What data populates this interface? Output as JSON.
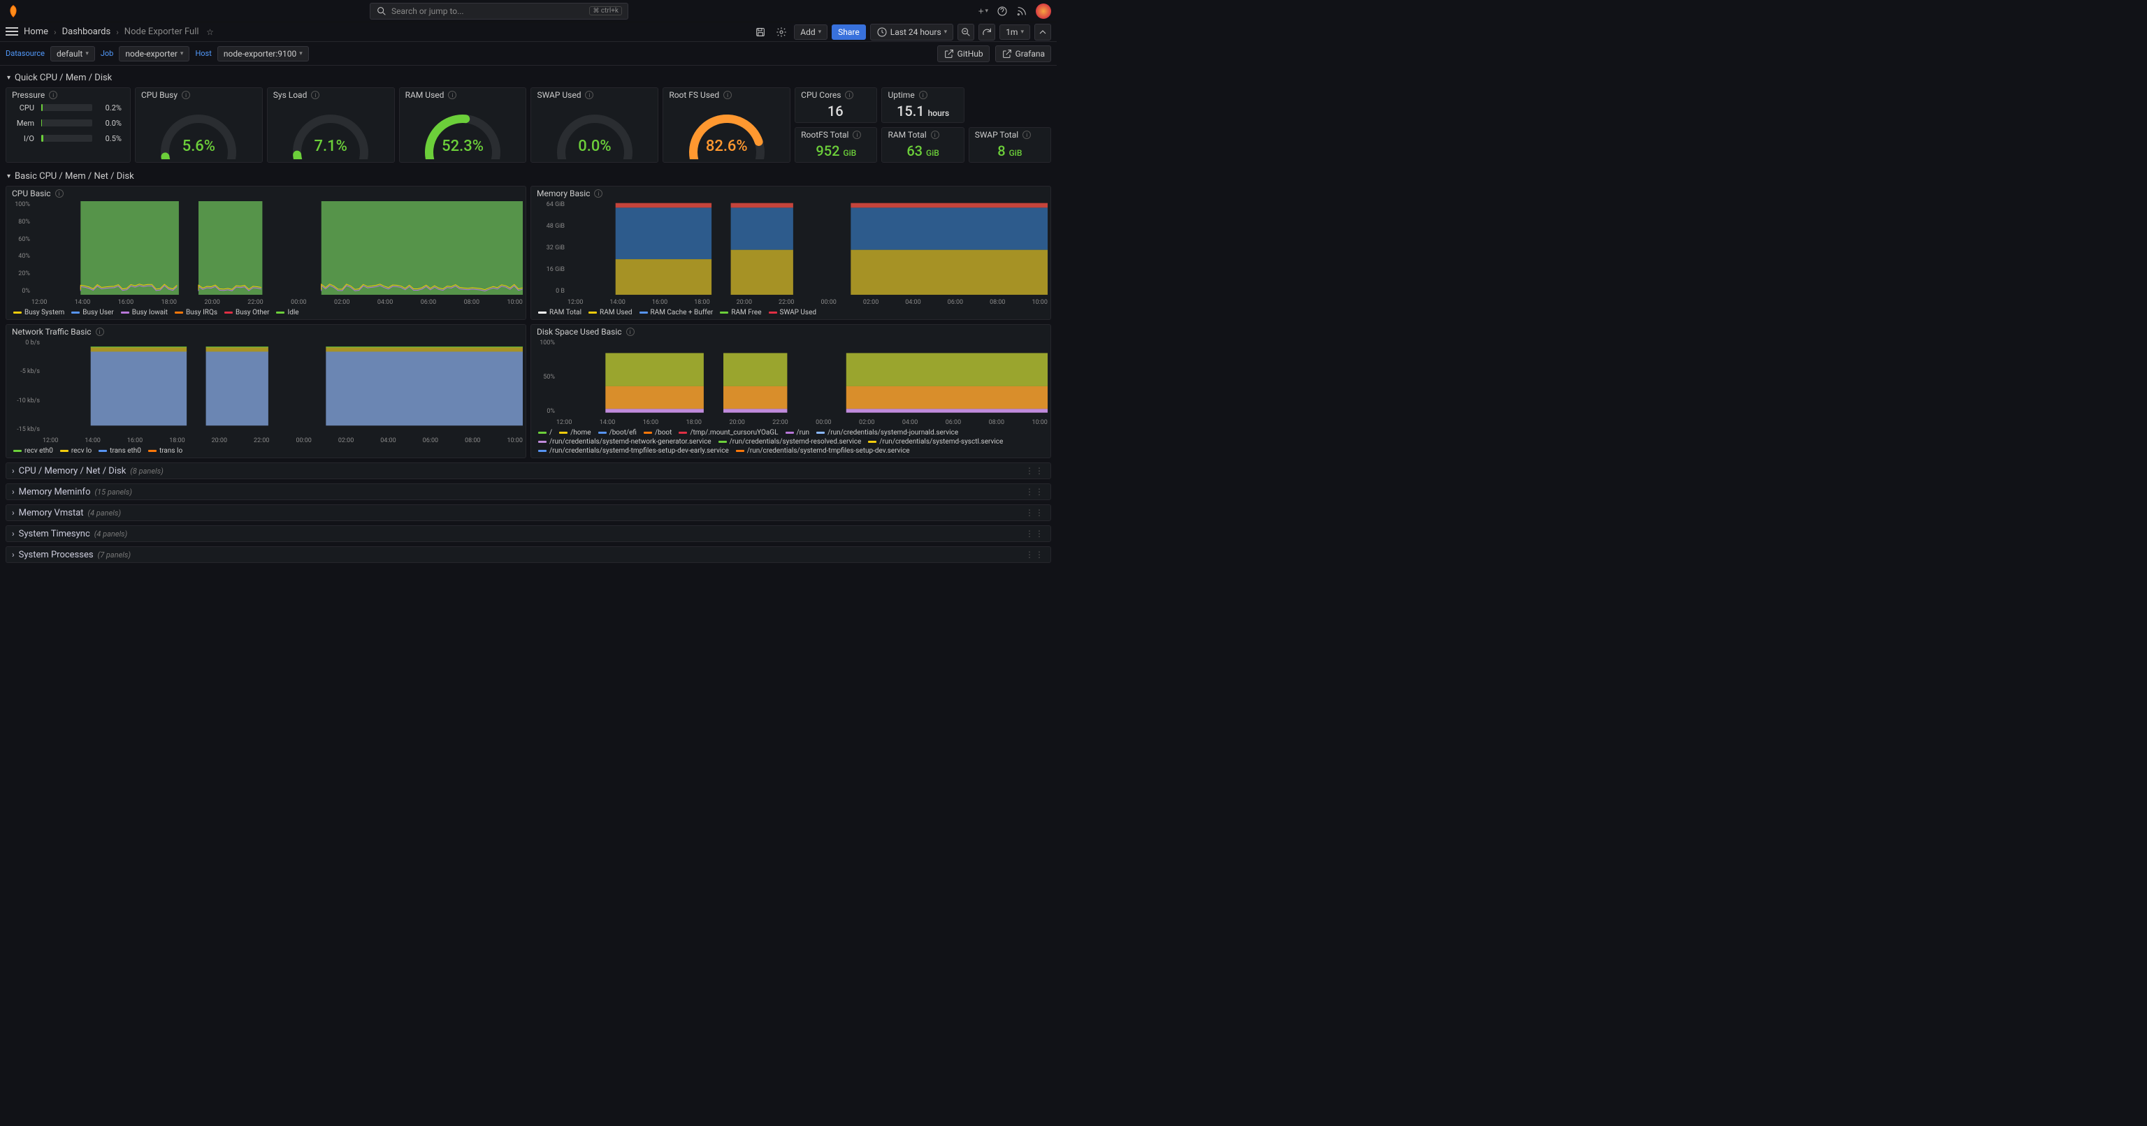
{
  "topbar": {
    "search_placeholder": "Search or jump to...",
    "search_kbd": "ctrl+k"
  },
  "breadcrumbs": {
    "home": "Home",
    "dashboards": "Dashboards",
    "page": "Node Exporter Full"
  },
  "toolbar": {
    "add": "Add",
    "share": "Share",
    "timerange": "Last 24 hours",
    "refresh_interval": "1m"
  },
  "vars": {
    "datasource_label": "Datasource",
    "datasource_value": "default",
    "job_label": "Job",
    "job_value": "node-exporter",
    "host_label": "Host",
    "host_value": "node-exporter:9100",
    "github_link": "GitHub",
    "grafana_link": "Grafana"
  },
  "section1": {
    "title": "Quick CPU / Mem / Disk"
  },
  "pressure": {
    "title": "Pressure",
    "rows": [
      {
        "label": "CPU",
        "value": "0.2%",
        "pct": 3
      },
      {
        "label": "Mem",
        "value": "0.0%",
        "pct": 2
      },
      {
        "label": "I/O",
        "value": "0.5%",
        "pct": 4
      }
    ]
  },
  "gauges": {
    "cpu_busy": {
      "title": "CPU Busy",
      "value": "5.6%",
      "pct": 5.6,
      "color": "#6ccf3a",
      "textcolor": "#6ccf3a"
    },
    "sys_load": {
      "title": "Sys Load",
      "value": "7.1%",
      "pct": 7.1,
      "color": "#6ccf3a",
      "textcolor": "#6ccf3a"
    },
    "ram_used": {
      "title": "RAM Used",
      "value": "52.3%",
      "pct": 52.3,
      "color": "#6ccf3a",
      "textcolor": "#6ccf3a"
    },
    "swap_used": {
      "title": "SWAP Used",
      "value": "0.0%",
      "pct": 0.0,
      "color": "#6ccf3a",
      "textcolor": "#6ccf3a"
    },
    "rootfs": {
      "title": "Root FS Used",
      "value": "82.6%",
      "pct": 82.6,
      "color": "#ff9830",
      "textcolor": "#ff9830"
    }
  },
  "stats": {
    "cpu_cores": {
      "title": "CPU Cores",
      "value": "16",
      "unit": ""
    },
    "uptime": {
      "title": "Uptime",
      "value": "15.1",
      "unit": "hours"
    },
    "rootfs_total": {
      "title": "RootFS Total",
      "value": "952",
      "unit": "GiB"
    },
    "ram_total": {
      "title": "RAM Total",
      "value": "63",
      "unit": "GiB"
    },
    "swap_total": {
      "title": "SWAP Total",
      "value": "8",
      "unit": "GiB"
    }
  },
  "section2": {
    "title": "Basic CPU / Mem / Net / Disk"
  },
  "cpu_basic": {
    "title": "CPU Basic",
    "yticks": [
      "100%",
      "80%",
      "60%",
      "40%",
      "20%",
      "0%"
    ],
    "legend": [
      {
        "name": "Busy System",
        "color": "#f2cc0c"
      },
      {
        "name": "Busy User",
        "color": "#5794f2"
      },
      {
        "name": "Busy Iowait",
        "color": "#b877d9"
      },
      {
        "name": "Busy IRQs",
        "color": "#ff780a"
      },
      {
        "name": "Busy Other",
        "color": "#e02f44"
      },
      {
        "name": "Idle",
        "color": "#6ccf3a"
      }
    ]
  },
  "memory_basic": {
    "title": "Memory Basic",
    "yticks": [
      "64 GiB",
      "48 GiB",
      "32 GiB",
      "16 GiB",
      "0 B"
    ],
    "legend": [
      {
        "name": "RAM Total",
        "color": "#ffffff"
      },
      {
        "name": "RAM Used",
        "color": "#f2cc0c"
      },
      {
        "name": "RAM Cache + Buffer",
        "color": "#5794f2"
      },
      {
        "name": "RAM Free",
        "color": "#6ccf3a"
      },
      {
        "name": "SWAP Used",
        "color": "#e02f44"
      }
    ]
  },
  "net_basic": {
    "title": "Network Traffic Basic",
    "yticks": [
      "0 b/s",
      "-5 kb/s",
      "-10 kb/s",
      "-15 kb/s"
    ],
    "legend": [
      {
        "name": "recv eth0",
        "color": "#6ccf3a"
      },
      {
        "name": "recv lo",
        "color": "#f2cc0c"
      },
      {
        "name": "trans eth0",
        "color": "#5794f2"
      },
      {
        "name": "trans lo",
        "color": "#ff780a"
      }
    ]
  },
  "disk_basic": {
    "title": "Disk Space Used Basic",
    "yticks": [
      "100%",
      "50%",
      "0%"
    ],
    "legend": [
      {
        "name": "/",
        "color": "#6ccf3a"
      },
      {
        "name": "/home",
        "color": "#f2cc0c"
      },
      {
        "name": "/boot/efi",
        "color": "#5794f2"
      },
      {
        "name": "/boot",
        "color": "#ff780a"
      },
      {
        "name": "/tmp/.mount_cursoruYOaGL",
        "color": "#e02f44"
      },
      {
        "name": "/run",
        "color": "#b877d9"
      },
      {
        "name": "/run/credentials/systemd-journald.service",
        "color": "#8ab8ff"
      },
      {
        "name": "/run/credentials/systemd-network-generator.service",
        "color": "#c08bdc"
      },
      {
        "name": "/run/credentials/systemd-resolved.service",
        "color": "#6ccf3a"
      },
      {
        "name": "/run/credentials/systemd-sysctl.service",
        "color": "#f2cc0c"
      },
      {
        "name": "/run/credentials/systemd-tmpfiles-setup-dev-early.service",
        "color": "#5794f2"
      },
      {
        "name": "/run/credentials/systemd-tmpfiles-setup-dev.service",
        "color": "#ff780a"
      }
    ]
  },
  "xticks": [
    "12:00",
    "14:00",
    "16:00",
    "18:00",
    "20:00",
    "22:00",
    "00:00",
    "02:00",
    "04:00",
    "06:00",
    "08:00",
    "10:00"
  ],
  "collapsed": [
    {
      "title": "CPU / Memory / Net / Disk",
      "count": "(8 panels)"
    },
    {
      "title": "Memory Meminfo",
      "count": "(15 panels)"
    },
    {
      "title": "Memory Vmstat",
      "count": "(4 panels)"
    },
    {
      "title": "System Timesync",
      "count": "(4 panels)"
    },
    {
      "title": "System Processes",
      "count": "(7 panels)"
    }
  ],
  "chart_data": [
    {
      "type": "area",
      "title": "CPU Basic",
      "xlabel": "",
      "ylabel": "",
      "ylim": [
        0,
        100
      ],
      "x_ticks": [
        "12:00",
        "14:00",
        "16:00",
        "18:00",
        "20:00",
        "22:00",
        "00:00",
        "02:00",
        "04:00",
        "06:00",
        "08:00",
        "10:00"
      ],
      "series": [
        {
          "name": "Idle",
          "values_pct_approx": 92
        },
        {
          "name": "Busy User",
          "values_pct_approx": 3
        },
        {
          "name": "Busy System",
          "values_pct_approx": 2
        },
        {
          "name": "Busy Iowait",
          "values_pct_approx": 1
        },
        {
          "name": "Busy IRQs",
          "values_pct_approx": 1
        },
        {
          "name": "Busy Other",
          "values_pct_approx": 1
        }
      ],
      "note": "Three visible data segments roughly 14:00-16:30, 17:00-19:30, 22:00-10:00; gaps elsewhere."
    },
    {
      "type": "area",
      "title": "Memory Basic",
      "x_ticks": [
        "12:00",
        "14:00",
        "16:00",
        "18:00",
        "20:00",
        "22:00",
        "00:00",
        "02:00",
        "04:00",
        "06:00",
        "08:00",
        "10:00"
      ],
      "ylim_gib": [
        0,
        64
      ],
      "series": [
        {
          "name": "RAM Total",
          "value_gib": 63
        },
        {
          "name": "RAM Used",
          "value_gib_approx": 18
        },
        {
          "name": "RAM Cache + Buffer",
          "value_gib_approx": 38
        },
        {
          "name": "RAM Free",
          "value_gib_approx": 7
        },
        {
          "name": "SWAP Used",
          "value_gib_approx": 0
        }
      ],
      "note": "Three visible data segments matching CPU Basic gaps."
    },
    {
      "type": "area",
      "title": "Network Traffic Basic",
      "x_ticks": [
        "12:00",
        "14:00",
        "16:00",
        "18:00",
        "20:00",
        "22:00",
        "00:00",
        "02:00",
        "04:00",
        "06:00",
        "08:00",
        "10:00"
      ],
      "ylim_kbs": [
        -15,
        0
      ],
      "series": [
        {
          "name": "recv eth0",
          "value_kbs_approx": 0.5
        },
        {
          "name": "recv lo",
          "value_kbs_approx": 0.1
        },
        {
          "name": "trans eth0",
          "value_kbs_approx": -12
        },
        {
          "name": "trans lo",
          "value_kbs_approx": -0.1
        }
      ]
    },
    {
      "type": "area",
      "title": "Disk Space Used Basic",
      "x_ticks": [
        "12:00",
        "14:00",
        "16:00",
        "18:00",
        "20:00",
        "22:00",
        "00:00",
        "02:00",
        "04:00",
        "06:00",
        "08:00",
        "10:00"
      ],
      "ylim_pct": [
        0,
        100
      ],
      "series": [
        {
          "name": "/",
          "value_pct_approx": 83
        },
        {
          "name": "/home",
          "value_pct_approx": 45
        },
        {
          "name": "/boot/efi",
          "value_pct_approx": 3
        },
        {
          "name": "/boot",
          "value_pct_approx": 8
        }
      ]
    }
  ]
}
